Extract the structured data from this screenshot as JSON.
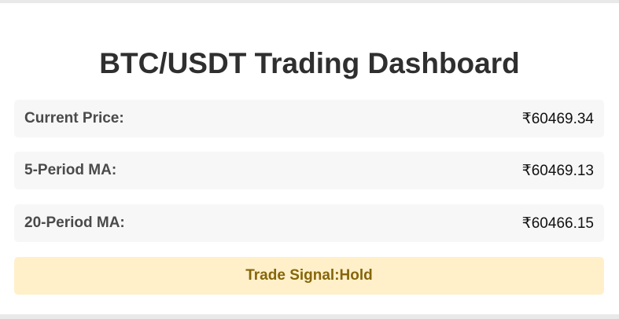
{
  "dashboard": {
    "title": "BTC/USDT Trading Dashboard",
    "rows": [
      {
        "label": "Current Price:",
        "value": "₹60469.34"
      },
      {
        "label": "5-Period MA:",
        "value": "₹60469.13"
      },
      {
        "label": "20-Period MA:",
        "value": "₹60466.15"
      }
    ],
    "signal": {
      "label": "Trade Signal:",
      "value": "Hold",
      "background": "#fff0c9",
      "color": "#86660b"
    }
  }
}
